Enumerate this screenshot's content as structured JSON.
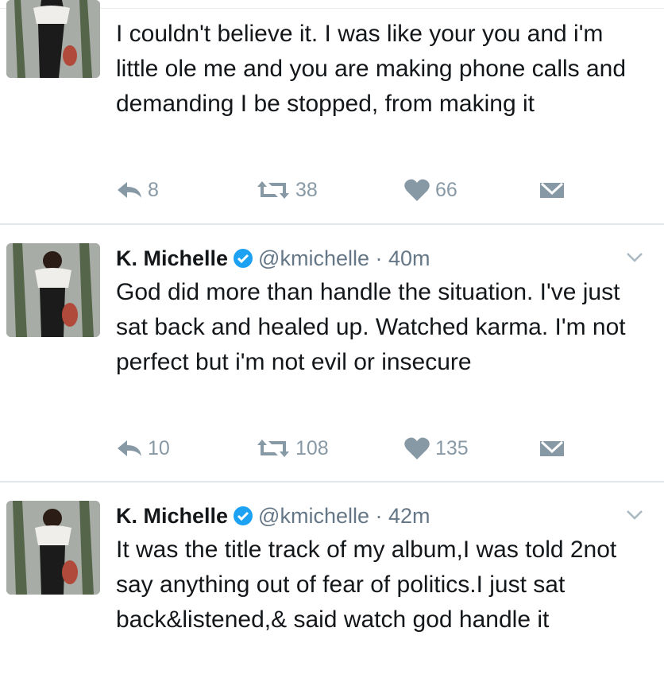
{
  "tweets": [
    {
      "name": "",
      "handle": "",
      "time": "",
      "text": "I couldn't believe it. I was like your you and i'm little ole me and you are making phone calls and demanding I be stopped, from making it",
      "replies": "8",
      "retweets": "38",
      "likes": "66"
    },
    {
      "name": "K. Michelle",
      "handle": "@kmichelle",
      "time": "· 40m",
      "text": "God did more than handle the situation. I've just sat back and healed up. Watched karma. I'm not perfect but i'm not evil or insecure",
      "replies": "10",
      "retweets": "108",
      "likes": "135"
    },
    {
      "name": "K. Michelle",
      "handle": "@kmichelle",
      "time": "· 42m",
      "text": "It was the title track of my album,I was told 2not say anything out of fear of politics.I just sat back&listened,& said watch god handle it"
    }
  ],
  "icons": {
    "reply": "reply-icon",
    "retweet": "retweet-icon",
    "like": "heart-icon",
    "dm": "envelope-icon",
    "verified": "verified-badge-icon",
    "more": "chevron-down-icon"
  },
  "colors": {
    "verified": "#1da1f2",
    "action": "#8899a6",
    "handle": "#657786",
    "divider": "#e1e8ed"
  }
}
